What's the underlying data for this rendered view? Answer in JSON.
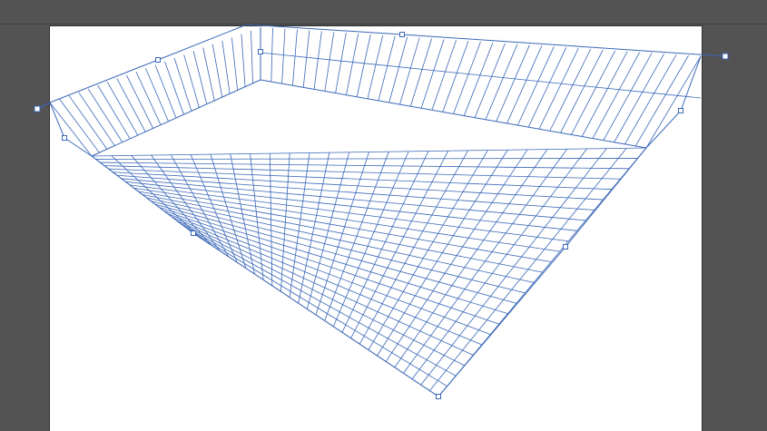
{
  "canvas": {
    "background": "#535353",
    "artboard_color": "#ffffff",
    "grid_color": "#3a67b8",
    "handle_fill": "#ffffff"
  },
  "tool": "perspective-grid-tool",
  "icons": {
    "handles": "square-control-point"
  }
}
